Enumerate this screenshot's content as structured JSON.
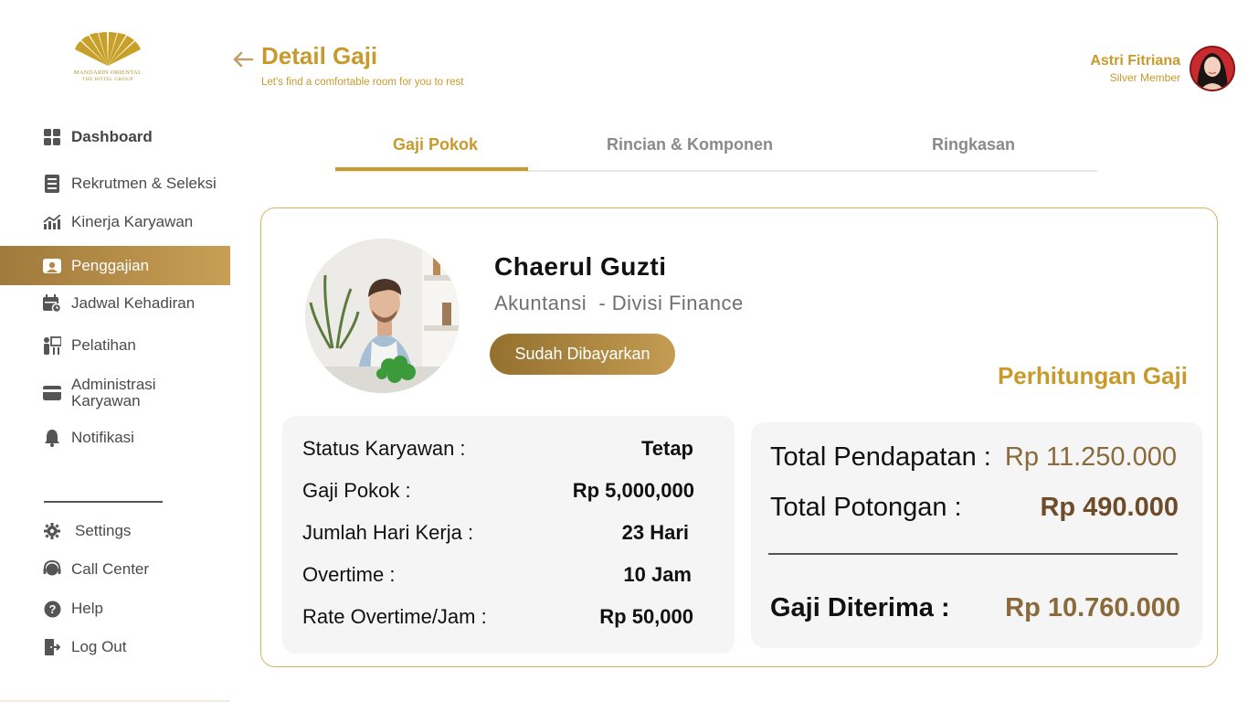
{
  "logo": {
    "brand": "MANDARIN ORIENTAL",
    "sub": "THE HOTEL GROUP"
  },
  "sidebar": {
    "items": [
      {
        "label": "Dashboard",
        "icon": "grid-icon"
      },
      {
        "label": "Rekrutmen & Seleksi",
        "icon": "document-list-icon"
      },
      {
        "label": "Kinerja Karyawan",
        "icon": "chart-trend-icon"
      },
      {
        "label": "Penggajian",
        "icon": "payroll-icon",
        "active": true
      },
      {
        "label": "Jadwal Kehadiran",
        "icon": "calendar-icon"
      },
      {
        "label": "Pelatihan",
        "icon": "training-icon"
      },
      {
        "label": "Administrasi Karyawan",
        "icon": "card-icon"
      },
      {
        "label": "Notifikasi",
        "icon": "bell-icon"
      }
    ],
    "bottom_items": [
      {
        "label": "Settings",
        "icon": "gear-icon"
      },
      {
        "label": "Call Center",
        "icon": "headset-icon"
      },
      {
        "label": "Help",
        "icon": "help-icon"
      },
      {
        "label": "Log Out",
        "icon": "logout-icon"
      }
    ]
  },
  "header": {
    "title": "Detail Gaji",
    "subtitle": "Let's find a comfortable room for you to rest"
  },
  "user": {
    "name": "Astri Fitriana",
    "role": "Silver Member"
  },
  "tabs": [
    {
      "label": "Gaji Pokok",
      "active": true
    },
    {
      "label": "Rincian & Komponen"
    },
    {
      "label": "Ringkasan"
    }
  ],
  "employee": {
    "name": "Chaerul Guzti",
    "department": "Akuntansi  - Divisi Finance",
    "status": "Sudah Dibayarkan"
  },
  "details": [
    {
      "label": "Status Karyawan :",
      "value": "Tetap"
    },
    {
      "label": "Gaji Pokok :",
      "value": "Rp 5,000,000"
    },
    {
      "label": "Jumlah Hari Kerja :",
      "value": "23 Hari"
    },
    {
      "label": "Overtime :",
      "value": "10 Jam"
    },
    {
      "label": "Rate Overtime/Jam :",
      "value": "Rp 50,000"
    }
  ],
  "calculation": {
    "title": "Perhitungan Gaji",
    "total_income_label": "Total Pendapatan :",
    "total_income_value": "Rp 11.250.000",
    "total_deduction_label": "Total Potongan :",
    "total_deduction_value": "Rp 490.000",
    "net_label": "Gaji Diterima :",
    "net_value": "Rp 10.760.000"
  },
  "colors": {
    "accent_gold": "#c89a2c",
    "active_gradient_start": "#a07a3c",
    "active_gradient_end": "#c89f55",
    "value_brown": "#8a6a3a",
    "net_brown": "#7a5a32"
  }
}
